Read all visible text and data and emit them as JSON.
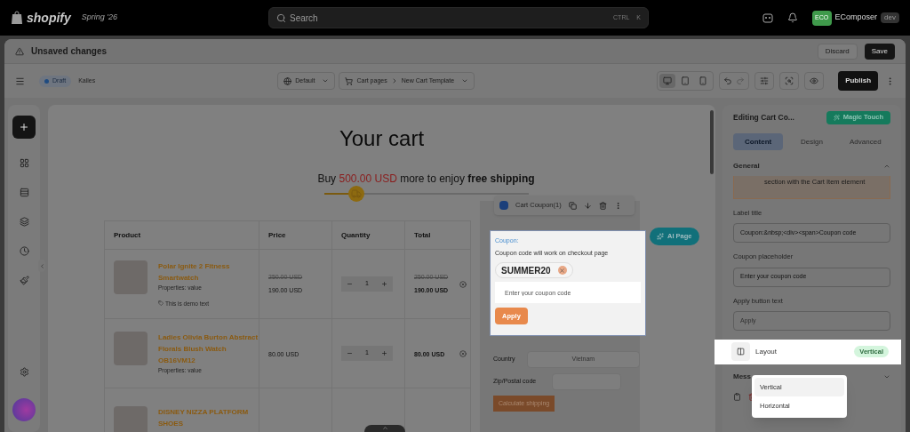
{
  "topbar": {
    "brand": "shopify",
    "badge": "Spring '26",
    "search": {
      "placeholder": "Search"
    },
    "shortcut": [
      "CTRL",
      "K"
    ],
    "store": {
      "initials": "ECO",
      "name": "EComposer",
      "tag": "dev"
    }
  },
  "save_bar": {
    "title": "Unsaved changes",
    "buttons": [
      "Discard",
      "Save"
    ]
  },
  "toolbar": {
    "status": "Draft",
    "theme": "Kalles",
    "language": "Default",
    "breadcrumb": [
      "Cart pages",
      "New Cart Template"
    ],
    "devices": [
      {
        "kind": "desktop",
        "selected": true
      },
      {
        "kind": "tablet",
        "selected": false
      },
      {
        "kind": "mobile",
        "selected": false
      }
    ],
    "publish": "Publish"
  },
  "canvas": {
    "heading": "Your cart",
    "shipping_message": {
      "before": "Buy",
      "amount": "500.00 USD",
      "middle": "more to enjoy",
      "highlight": "free shipping"
    },
    "progress": {
      "level": 0.16
    },
    "table": {
      "columns": [
        "Product",
        "Price",
        "Quantity",
        "Total"
      ],
      "rows": [
        {
          "name": "Polar Ignite 2 Fitness Smartwatch",
          "properties": "Properties: value",
          "note": "This is demo text",
          "old_price": "250.00 USD",
          "price": "190.00 USD",
          "quantity": "1",
          "old_total": "250.00 USD",
          "total": "190.00 USD"
        },
        {
          "name": "Ladies Olivia Burton Abstract Florals Blush Watch OB16VM12",
          "properties": "Properties: value",
          "price": "80.00 USD",
          "quantity": "1",
          "total": "80.00 USD"
        },
        {
          "name": "DISNEY NIZZA PLATFORM SHOES"
        }
      ]
    },
    "element_toolbar": {
      "label": "Cart Coupon(1)"
    },
    "ai_button": "AI Page",
    "coupon": {
      "title": "Coupon:",
      "description": "Coupon code will work on checkout page",
      "applied_code": "SUMMER20",
      "placeholder": "Enter your coupon code",
      "button": "Apply"
    },
    "shipping": {
      "country_label": "Country",
      "country": "Vietnam",
      "zip_label": "Zip/Postal code",
      "button": "Calculate shipping"
    }
  },
  "panel": {
    "title": "Editing Cart Co...",
    "magic_button": "Magic Touch",
    "tabs": [
      {
        "label": "Content",
        "selected": true
      },
      {
        "label": "Design",
        "selected": false
      },
      {
        "label": "Advanced",
        "selected": false
      }
    ],
    "section": {
      "title": "General",
      "expanded": true
    },
    "notice": "section with the Cart Item element",
    "fields": [
      {
        "label": "Label title",
        "value": "Coupon:&nbsp;<div><span>Coupon code"
      },
      {
        "label": "Coupon placeholder",
        "value": "Enter your coupon code"
      },
      {
        "label": "Apply button text",
        "placeholder": "Apply"
      }
    ],
    "layout": {
      "label": "Layout",
      "value": "Vertical",
      "options": [
        {
          "label": "Vertical",
          "selected": true
        },
        {
          "label": "Horizontal",
          "selected": false
        }
      ]
    },
    "collapsed_section": {
      "title": "Mess",
      "expanded": false
    }
  }
}
